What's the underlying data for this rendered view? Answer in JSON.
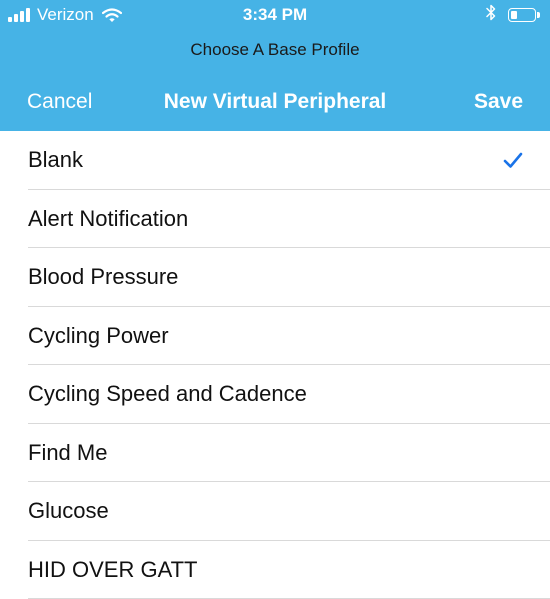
{
  "status_bar": {
    "carrier": "Verizon",
    "time": "3:34 PM",
    "battery_level": 0.3,
    "icons": [
      "signal-bars-icon",
      "wifi-icon",
      "bluetooth-icon",
      "battery-icon"
    ]
  },
  "header": {
    "prompt": "Choose A Base Profile",
    "cancel_label": "Cancel",
    "title": "New Virtual Peripheral",
    "save_label": "Save",
    "background_color": "#46b3e6"
  },
  "profiles": {
    "selected_index": 0,
    "checkmark_color": "#1a73e8",
    "items": [
      {
        "label": "Blank"
      },
      {
        "label": "Alert Notification"
      },
      {
        "label": "Blood Pressure"
      },
      {
        "label": "Cycling Power"
      },
      {
        "label": "Cycling Speed and Cadence"
      },
      {
        "label": "Find Me"
      },
      {
        "label": "Glucose"
      },
      {
        "label": "HID OVER GATT"
      }
    ]
  }
}
